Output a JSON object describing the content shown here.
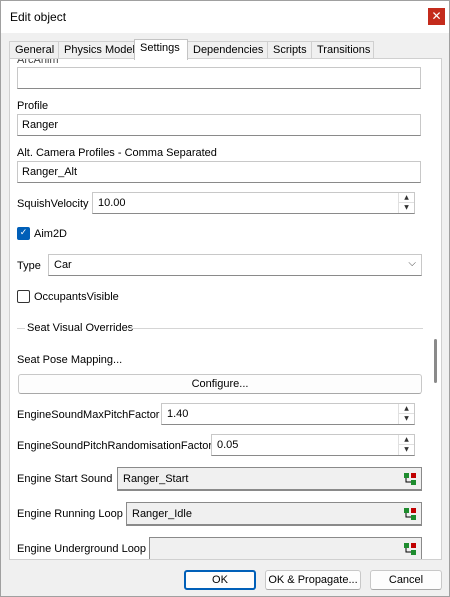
{
  "window": {
    "title": "Edit object",
    "close_icon": "close-icon"
  },
  "tabs": [
    {
      "label": "General"
    },
    {
      "label": "Physics Model"
    },
    {
      "label": "Settings"
    },
    {
      "label": "Dependencies"
    },
    {
      "label": "Scripts"
    },
    {
      "label": "Transitions"
    }
  ],
  "settings": {
    "cut_label": "ArcAnim",
    "profile": {
      "label": "Profile",
      "value": "Ranger"
    },
    "alt_camera": {
      "label": "Alt. Camera Profiles - Comma Separated",
      "value": "Ranger_Alt"
    },
    "squish": {
      "label": "SquishVelocity",
      "value": "10.00"
    },
    "aim2d": {
      "label": "Aim2D",
      "checked": true
    },
    "type": {
      "label": "Type",
      "value": "Car"
    },
    "occupants": {
      "label": "OccupantsVisible",
      "checked": false
    },
    "seat_group": {
      "label": "Seat Visual Overrides"
    },
    "seat_pose": {
      "label": "Seat Pose Mapping...",
      "button": "Configure..."
    },
    "max_pitch": {
      "label": "EngineSoundMaxPitchFactor",
      "value": "1.40"
    },
    "pitch_random": {
      "label": "EngineSoundPitchRandomisationFactor",
      "value": "0.05"
    },
    "start_sound": {
      "label": "Engine Start Sound",
      "value": "Ranger_Start"
    },
    "running_loop": {
      "label": "Engine Running Loop",
      "value": "Ranger_Idle"
    },
    "underground_loop": {
      "label": "Engine Underground Loop",
      "value": ""
    }
  },
  "footer": {
    "ok": "OK",
    "ok_propagate": "OK & Propagate...",
    "cancel": "Cancel"
  },
  "colors": {
    "accent": "#005fb8",
    "close": "#c42b1c",
    "picker_green": "#1e8c2e",
    "picker_red": "#c00000"
  }
}
